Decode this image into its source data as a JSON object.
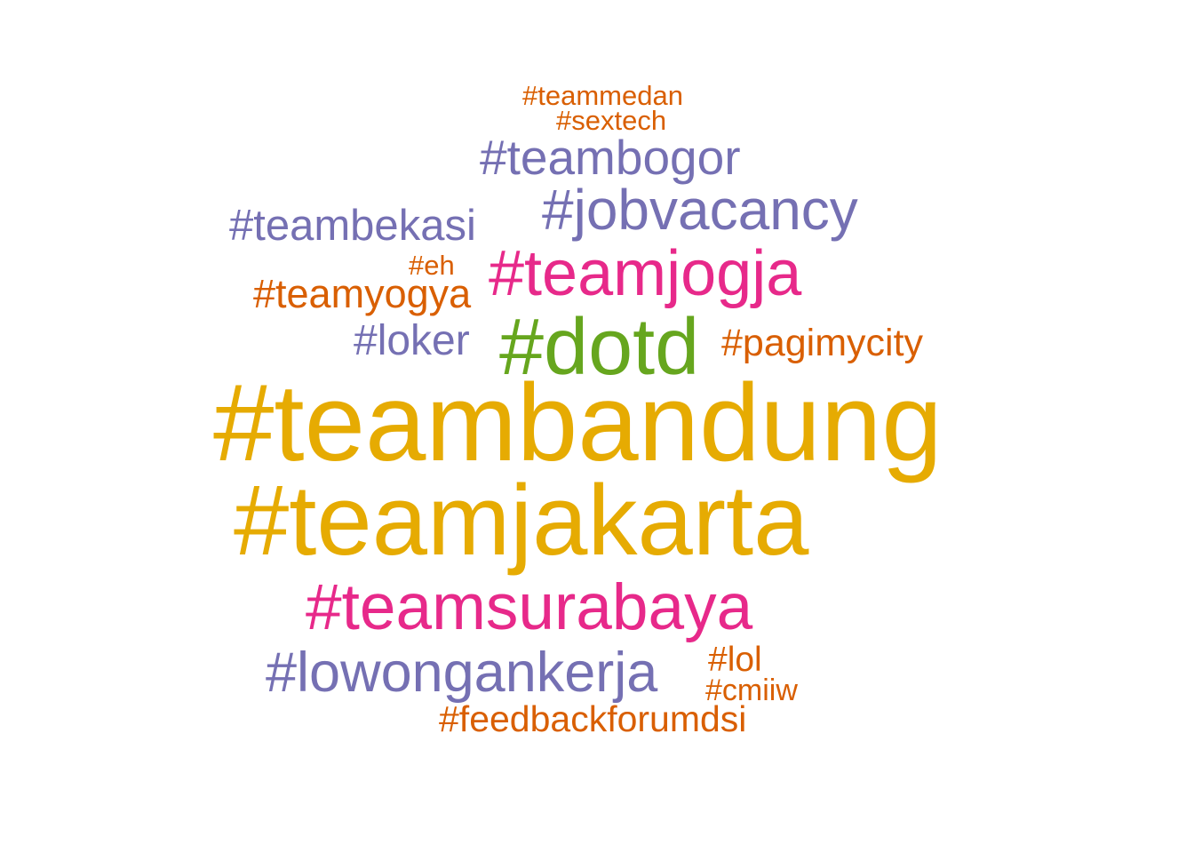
{
  "colors": {
    "orange": "#d95f02",
    "purple": "#7570b3",
    "magenta": "#e7298a",
    "green": "#66a61e",
    "gold": "#e6ab02"
  },
  "words": [
    {
      "text": "#teammedan",
      "color": "#d95f02"
    },
    {
      "text": "#sextech",
      "color": "#d95f02"
    },
    {
      "text": "#teambogor",
      "color": "#7570b3"
    },
    {
      "text": "#jobvacancy",
      "color": "#7570b3"
    },
    {
      "text": "#teambekasi",
      "color": "#7570b3"
    },
    {
      "text": "#eh",
      "color": "#d95f02"
    },
    {
      "text": "#teamjogja",
      "color": "#e7298a"
    },
    {
      "text": "#teamyogya",
      "color": "#d95f02"
    },
    {
      "text": "#loker",
      "color": "#7570b3"
    },
    {
      "text": "#dotd",
      "color": "#66a61e"
    },
    {
      "text": "#pagimycity",
      "color": "#d95f02"
    },
    {
      "text": "#teambandung",
      "color": "#e6ab02"
    },
    {
      "text": "#teamjakarta",
      "color": "#e6ab02"
    },
    {
      "text": "#teamsurabaya",
      "color": "#e7298a"
    },
    {
      "text": "#lowongankerja",
      "color": "#7570b3"
    },
    {
      "text": "#lol",
      "color": "#d95f02"
    },
    {
      "text": "#cmiiw",
      "color": "#d95f02"
    },
    {
      "text": "#feedbackforumdsi",
      "color": "#d95f02"
    }
  ]
}
